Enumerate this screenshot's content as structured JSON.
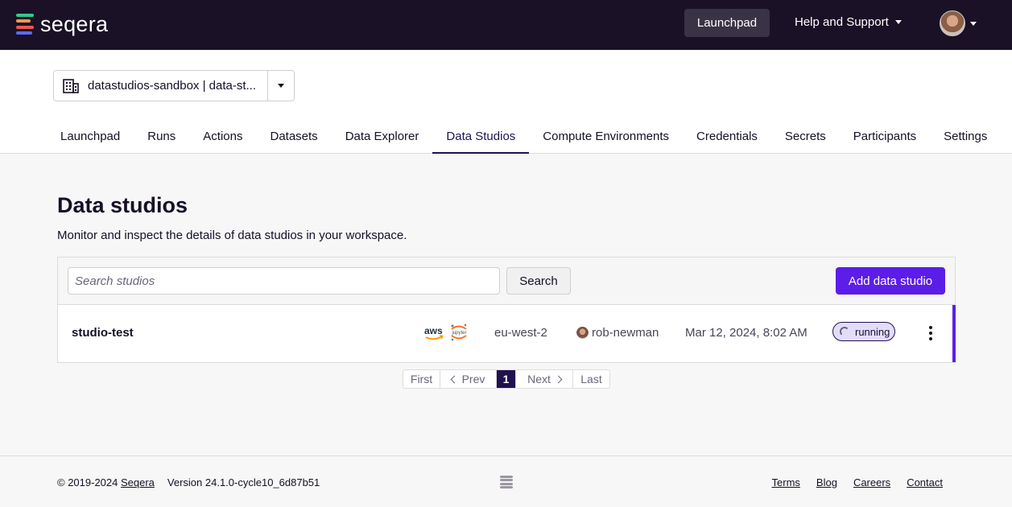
{
  "topbar": {
    "logo_text": "seqera",
    "nav_launchpad": "Launchpad",
    "help_label": "Help and Support"
  },
  "workspace": {
    "name": "datastudios-sandbox | data-st..."
  },
  "tabs": [
    {
      "label": "Launchpad"
    },
    {
      "label": "Runs"
    },
    {
      "label": "Actions"
    },
    {
      "label": "Datasets"
    },
    {
      "label": "Data Explorer"
    },
    {
      "label": "Data Studios"
    },
    {
      "label": "Compute Environments"
    },
    {
      "label": "Credentials"
    },
    {
      "label": "Secrets"
    },
    {
      "label": "Participants"
    },
    {
      "label": "Settings"
    }
  ],
  "active_tab": "Data Studios",
  "page": {
    "title": "Data studios",
    "subtitle": "Monitor and inspect the details of data studios in your workspace."
  },
  "toolbar": {
    "search_placeholder": "Search studios",
    "search_label": "Search",
    "add_label": "Add data studio"
  },
  "studio": {
    "name": "studio-test",
    "provider_icon": "aws-icon",
    "tool_icon": "jupyter-icon",
    "region": "eu-west-2",
    "user": "rob-newman",
    "created": "Mar 12, 2024, 8:02 AM",
    "status": "running"
  },
  "pagination": {
    "first": "First",
    "prev": "Prev",
    "current": "1",
    "next": "Next",
    "last": "Last"
  },
  "footer": {
    "copyright": "© 2019-2024 ",
    "company": "Seqera",
    "version": "Version 24.1.0-cycle10_6d87b51",
    "links": [
      "Terms",
      "Blog",
      "Careers",
      "Contact"
    ]
  },
  "colors": {
    "navbar": "#1a1126",
    "accent": "#5c1de8",
    "active_tab": "#201250",
    "status_bg": "#e4dcfb"
  }
}
